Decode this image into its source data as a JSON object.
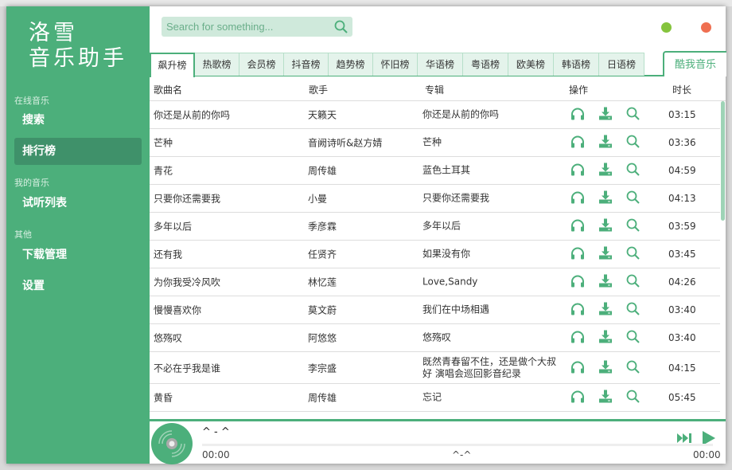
{
  "app": {
    "logo_line1": "洛雪",
    "logo_line2": "音乐助手"
  },
  "sidebar": {
    "sections": [
      {
        "label": "在线音乐",
        "items": [
          {
            "label": "搜索"
          },
          {
            "label": "排行榜",
            "active": true
          }
        ]
      },
      {
        "label": "我的音乐",
        "items": [
          {
            "label": "试听列表"
          }
        ]
      },
      {
        "label": "其他",
        "items": [
          {
            "label": "下载管理"
          },
          {
            "label": "设置"
          }
        ]
      }
    ]
  },
  "search": {
    "placeholder": "Search for something..."
  },
  "window_controls": {
    "minimize_color": "#85c43d",
    "close_color": "#ef6f51"
  },
  "tabs": [
    {
      "label": "飙升榜",
      "active": true
    },
    {
      "label": "热歌榜"
    },
    {
      "label": "会员榜"
    },
    {
      "label": "抖音榜"
    },
    {
      "label": "趋势榜"
    },
    {
      "label": "怀旧榜"
    },
    {
      "label": "华语榜"
    },
    {
      "label": "粤语榜"
    },
    {
      "label": "欧美榜"
    },
    {
      "label": "韩语榜"
    },
    {
      "label": "日语榜"
    }
  ],
  "source": {
    "label": "酷我音乐"
  },
  "table": {
    "headers": {
      "name": "歌曲名",
      "singer": "歌手",
      "album": "专辑",
      "ops": "操作",
      "duration": "时长"
    },
    "rows": [
      {
        "name": "你还是从前的你吗",
        "singer": "天籁天",
        "album": "你还是从前的你吗",
        "duration": "03:15"
      },
      {
        "name": "芒种",
        "singer": "音阙诗听&赵方婧",
        "album": "芒种",
        "duration": "03:36"
      },
      {
        "name": "青花",
        "singer": "周传雄",
        "album": "蓝色土耳其",
        "duration": "04:59"
      },
      {
        "name": "只要你还需要我",
        "singer": "小曼",
        "album": "只要你还需要我",
        "duration": "04:13"
      },
      {
        "name": "多年以后",
        "singer": "季彦霖",
        "album": "多年以后",
        "duration": "03:59"
      },
      {
        "name": "还有我",
        "singer": "任贤齐",
        "album": "如果没有你",
        "duration": "03:45"
      },
      {
        "name": "为你我受冷风吹",
        "singer": "林忆莲",
        "album": "Love,Sandy",
        "duration": "04:26"
      },
      {
        "name": "慢慢喜欢你",
        "singer": "莫文蔚",
        "album": "我们在中场相遇",
        "duration": "03:40"
      },
      {
        "name": "悠殇叹",
        "singer": "阿悠悠",
        "album": "悠殇叹",
        "duration": "03:40"
      },
      {
        "name": "不必在乎我是谁",
        "singer": "李宗盛",
        "album": "既然青春留不住，还是做个大叔好 演唱会巡回影音纪录",
        "duration": "04:15"
      },
      {
        "name": "黄昏",
        "singer": "周传雄",
        "album": "忘记",
        "duration": "05:45"
      }
    ]
  },
  "player": {
    "title": "^ - ^",
    "current_time": "00:00",
    "center_text": "^-^",
    "total_time": "00:00",
    "progress": 0
  },
  "colors": {
    "accent": "#4caf7b",
    "sidebar_active": "#3f916a"
  }
}
